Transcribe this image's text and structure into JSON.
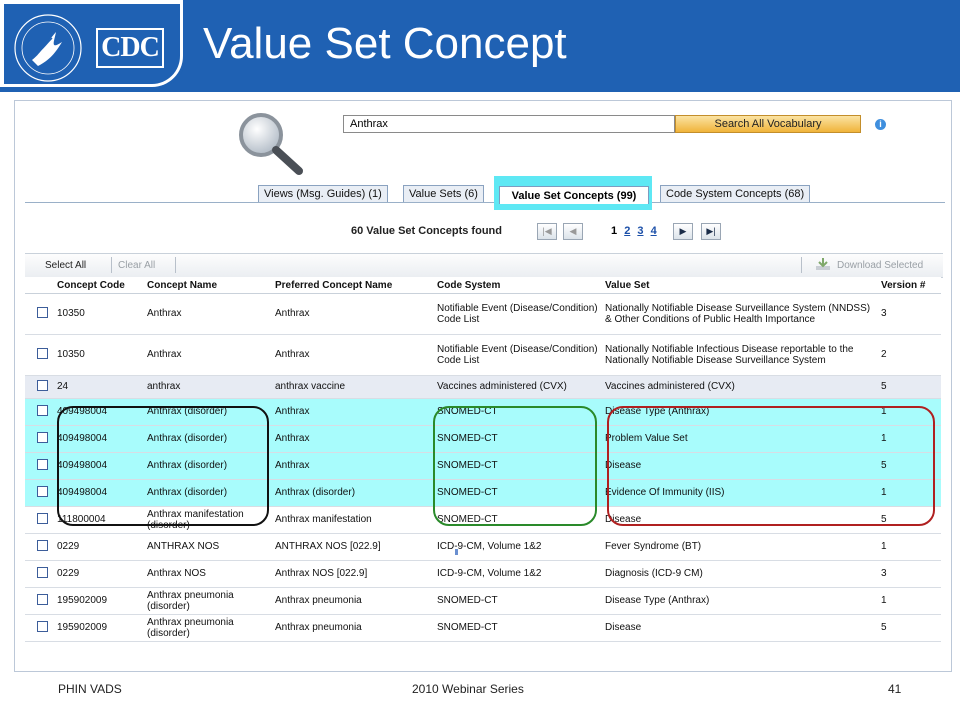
{
  "header": {
    "logo_text": "CDC",
    "seal_text": "DEPARTMENT OF HEALTH & HUMAN SERVICES • USA",
    "title": "Value Set Concept"
  },
  "search": {
    "value": "Anthrax",
    "button_label": "Search All Vocabulary",
    "info_icon": "i"
  },
  "tabs": [
    {
      "label": "Views (Msg. Guides) (1)",
      "active": false
    },
    {
      "label": "Value Sets (6)",
      "active": false
    },
    {
      "label": "Value Set Concepts (99)",
      "active": true
    },
    {
      "label": "Code System Concepts (68)",
      "active": false
    }
  ],
  "results": {
    "found_text": "60 Value Set Concepts found",
    "first_icon": "|◀",
    "prev_icon": "◀",
    "next_icon": "▶",
    "last_icon": "▶|",
    "current_page": "1",
    "pages": [
      "2",
      "3",
      "4"
    ]
  },
  "toolbar": {
    "select_all": "Select All",
    "clear_all": "Clear All",
    "download_selected": "Download Selected"
  },
  "table": {
    "headers": [
      "Concept Code",
      "Concept Name",
      "Preferred Concept Name",
      "Code System",
      "Value Set",
      "Version #"
    ],
    "rows": [
      {
        "code": "10350",
        "name": "Anthrax",
        "preferred": "Anthrax",
        "system": "Notifiable Event (Disease/Condition) Code List",
        "value_set": "Nationally Notifiable Disease Surveillance System (NNDSS) & Other Conditions of Public Health Importance",
        "version": "3",
        "style": ""
      },
      {
        "code": "10350",
        "name": "Anthrax",
        "preferred": "Anthrax",
        "system": "Notifiable Event (Disease/Condition) Code List",
        "value_set": "Nationally Notifiable Infectious Disease reportable to the Nationally Notifiable Disease Surveillance System",
        "version": "2",
        "style": ""
      },
      {
        "code": "24",
        "name": "anthrax",
        "preferred": "anthrax vaccine",
        "system": "Vaccines administered (CVX)",
        "value_set": "Vaccines administered (CVX)",
        "version": "5",
        "style": "grey"
      },
      {
        "code": "409498004",
        "name": "Anthrax (disorder)",
        "preferred": "Anthrax",
        "system": "SNOMED-CT",
        "value_set": "Disease Type (Anthrax)",
        "version": "1",
        "style": "hl"
      },
      {
        "code": "409498004",
        "name": "Anthrax (disorder)",
        "preferred": "Anthrax",
        "system": "SNOMED-CT",
        "value_set": "Problem Value Set",
        "version": "1",
        "style": "hl"
      },
      {
        "code": "409498004",
        "name": "Anthrax (disorder)",
        "preferred": "Anthrax",
        "system": "SNOMED-CT",
        "value_set": "Disease",
        "version": "5",
        "style": "hl"
      },
      {
        "code": "409498004",
        "name": "Anthrax (disorder)",
        "preferred": "Anthrax (disorder)",
        "system": "SNOMED-CT",
        "value_set": "Evidence Of Immunity (IIS)",
        "version": "1",
        "style": "hl"
      },
      {
        "code": "111800004",
        "name": "Anthrax manifestation (disorder)",
        "preferred": "Anthrax manifestation",
        "system": "SNOMED-CT",
        "value_set": "Disease",
        "version": "5",
        "style": ""
      },
      {
        "code": "0229",
        "name": "ANTHRAX NOS",
        "preferred": "ANTHRAX NOS [022.9]",
        "system": "ICD-9-CM, Volume 1&2",
        "value_set": "Fever Syndrome (BT)",
        "version": "1",
        "style": ""
      },
      {
        "code": "0229",
        "name": "Anthrax NOS",
        "preferred": "Anthrax NOS [022.9]",
        "system": "ICD-9-CM, Volume 1&2",
        "value_set": "Diagnosis (ICD-9 CM)",
        "version": "3",
        "style": ""
      },
      {
        "code": "195902009",
        "name": "Anthrax pneumonia (disorder)",
        "preferred": "Anthrax pneumonia",
        "system": "SNOMED-CT",
        "value_set": "Disease Type (Anthrax)",
        "version": "1",
        "style": ""
      },
      {
        "code": "195902009",
        "name": "Anthrax pneumonia (disorder)",
        "preferred": "Anthrax pneumonia",
        "system": "SNOMED-CT",
        "value_set": "Disease",
        "version": "5",
        "style": ""
      }
    ]
  },
  "footer": {
    "left": "PHIN VADS",
    "center": "2010 Webinar Series",
    "right": "41"
  },
  "colors": {
    "banner": "#1f61b3",
    "highlight": "#a8fcfc",
    "tab_highlight": "#5ee8f4",
    "search_button": "#f0b33a",
    "oval_black": "#111111",
    "oval_green": "#2a8a2a",
    "oval_red": "#b02020"
  },
  "icons": {
    "magnifier": "magnifier-icon",
    "info": "info-icon",
    "download": "download-icon",
    "hhs_seal": "hhs-seal-icon"
  }
}
